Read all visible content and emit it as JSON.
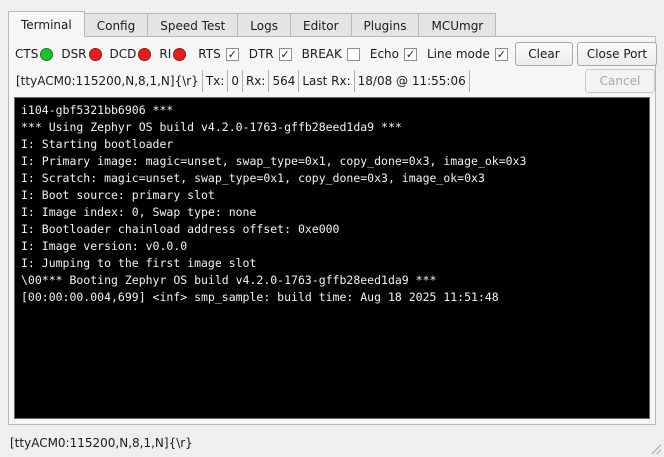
{
  "tabs": [
    {
      "label": "Terminal",
      "active": true
    },
    {
      "label": "Config",
      "active": false
    },
    {
      "label": "Speed Test",
      "active": false
    },
    {
      "label": "Logs",
      "active": false
    },
    {
      "label": "Editor",
      "active": false
    },
    {
      "label": "Plugins",
      "active": false
    },
    {
      "label": "MCUmgr",
      "active": false
    }
  ],
  "signals": {
    "cts": {
      "label": "CTS",
      "color": "#1fbf2e"
    },
    "dsr": {
      "label": "DSR",
      "color": "#e32020"
    },
    "dcd": {
      "label": "DCD",
      "color": "#e32020"
    },
    "ri": {
      "label": "RI",
      "color": "#e32020"
    }
  },
  "toggles": {
    "rts": {
      "label": "RTS",
      "checked": true,
      "mark": "✓"
    },
    "dtr": {
      "label": "DTR",
      "checked": true,
      "mark": "✓"
    },
    "break": {
      "label": "BREAK",
      "checked": false,
      "mark": ""
    },
    "echo": {
      "label": "Echo",
      "checked": true,
      "mark": "✓"
    },
    "line_mode": {
      "label": "Line mode",
      "checked": true,
      "mark": "✓"
    }
  },
  "buttons": {
    "clear": "Clear",
    "close_port": "Close Port",
    "cancel": "Cancel"
  },
  "status": {
    "port_settings": "[ttyACM0:115200,N,8,1,N]{\\r}",
    "tx_label": "Tx:",
    "tx_value": "0",
    "rx_label": "Rx:",
    "rx_value": "564",
    "last_rx_label": "Last Rx:",
    "last_rx_value": "18/08 @ 11:55:06"
  },
  "terminal_lines": [
    "i104-gbf5321bb6906 ***",
    "*** Using Zephyr OS build v4.2.0-1763-gffb28eed1da9 ***",
    "I: Starting bootloader",
    "I: Primary image: magic=unset, swap_type=0x1, copy_done=0x3, image_ok=0x3",
    "I: Scratch: magic=unset, swap_type=0x1, copy_done=0x3, image_ok=0x3",
    "I: Boot source: primary slot",
    "I: Image index: 0, Swap type: none",
    "I: Bootloader chainload address offset: 0xe000",
    "I: Image version: v0.0.0",
    "I: Jumping to the first image slot",
    "\\00*** Booting Zephyr OS build v4.2.0-1763-gffb28eed1da9 ***",
    "[00:00:00.004,699] <inf> smp_sample: build time: Aug 18 2025 11:51:48"
  ],
  "statusbar": {
    "text": "[ttyACM0:115200,N,8,1,N]{\\r}"
  }
}
